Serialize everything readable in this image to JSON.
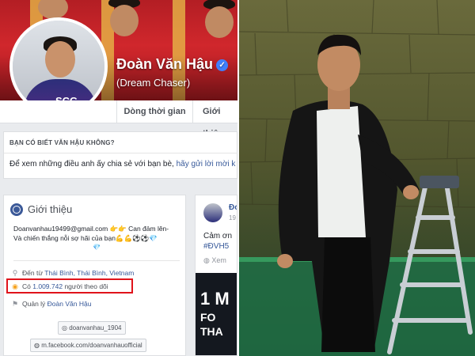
{
  "profile": {
    "name": "Đoàn Văn Hậu",
    "nickname": "(Dream Chaser)",
    "avatar_badge": "SCG",
    "verified_icon": "✓"
  },
  "tabs": [
    "Dòng thời gian",
    "Giới thiệ"
  ],
  "know_box": {
    "title": "BẠN CÓ BIẾT VĂN HẬU KHÔNG?",
    "text": "Để xem những điều anh ấy chia sẻ với bạn bè,",
    "link": "hãy gửi lời mời k"
  },
  "intro": {
    "title": "Giới thiệu",
    "bio_line1": "Doanvanhau19499@gmail.com 👉👉 Can đảm lên-",
    "bio_line2": "Và chiến thắng nỗi sợ hãi của bạn💪💪⚽⚽💎",
    "bio_line3": "💎",
    "from_prefix": "Đến từ",
    "from_place": "Thái Bình, Thái Bình, Vietnam",
    "followers_prefix": "Có",
    "followers_count": "1.009.742",
    "followers_suffix": "người theo dõi",
    "managed_prefix": "Quản lý",
    "managed_by": "Đoàn Văn Hậu",
    "instagram": "doanvanhau_1904",
    "facebook_url": "m.facebook.com/doanvanhauofficial"
  },
  "post": {
    "name": "Đo",
    "time": "19",
    "line1": "Cảm ơn",
    "tag": "#ĐVH5",
    "more": "Xem",
    "img_line1": "1 M",
    "img_line2": "FO",
    "img_line3": "THA"
  },
  "colors": {
    "facebook_blue": "#3b5998",
    "link": "#365899",
    "highlight_red": "#e0131b",
    "verified": "#4080ff"
  },
  "icons": {
    "location": "⚲",
    "rss": "◉",
    "flag": "⚑",
    "instagram": "◎",
    "globe": "◍"
  }
}
